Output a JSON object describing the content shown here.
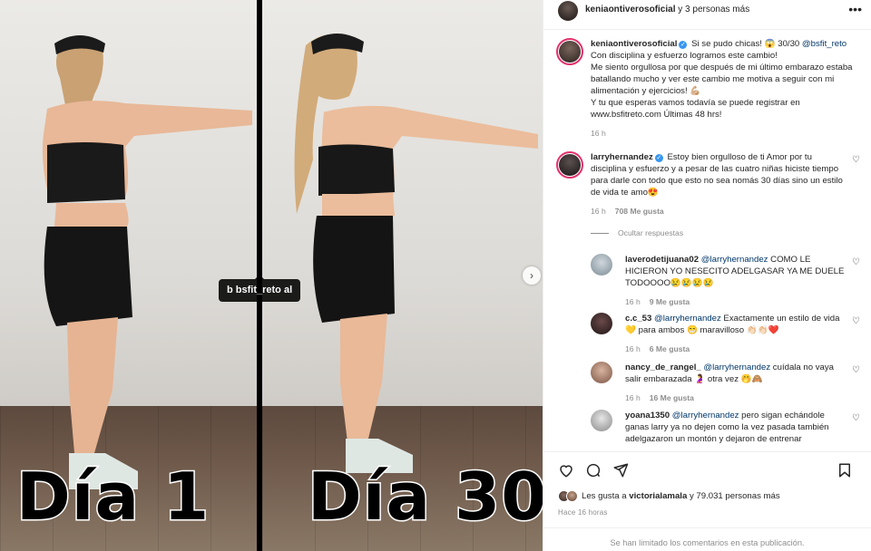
{
  "media": {
    "left_label": "Día 1",
    "right_label": "Día 30",
    "tag_label": "b   bsfit_reto   al",
    "next_icon": "chevron-right-icon"
  },
  "header": {
    "owner": "keniaontiverosoficial",
    "others": " y 3 personas más",
    "more_icon": "more-horizontal-icon"
  },
  "caption": {
    "user": "keniaontiverosoficial",
    "text_1": " Si se pudo chicas! 😱 30/30 ",
    "mention": "@bsfit_reto",
    "text_2": "Con disciplina y esfuerzo logramos este cambio!",
    "text_3": "Me siento orgullosa por que después de mi último embarazo estaba batallando mucho y ver este cambio me motiva a seguir con mi alimentación y ejercicios! 💪🏼",
    "text_4": "Y tu que esperas vamos todavía se puede registrar en www.bsfitreto.com Últimas 48 hrs!",
    "time": "16 h"
  },
  "comment_main": {
    "user": "larryhernandez",
    "text": " Estoy bien orgulloso de ti Amor por tu disciplina y esfuerzo y a pesar de las cuatro niñas hiciste tiempo para darle con todo que esto no sea nomás 30 días sino un estilo de vida te amo😍",
    "time": "16 h",
    "likes": "708 Me gusta"
  },
  "hide_replies": "Ocultar respuestas",
  "replies": [
    {
      "user": "laverodetijuana02",
      "mention": "@larryhernandez",
      "text": " COMO LE HICIERON YO NESECITO ADELGASAR YA ME DUELE TODOOOO😢😢😢😢",
      "time": "16 h",
      "likes": "9 Me gusta"
    },
    {
      "user": "c.c_53",
      "mention": "@larryhernandez",
      "text": " Exactamente un estilo de vida 💛 para ambos 😁 maravilloso 👏🏻👏🏻❤️",
      "time": "16 h",
      "likes": "6 Me gusta"
    },
    {
      "user": "nancy_de_rangel_",
      "mention": "@larryhernandez",
      "text": " cuídala no vaya salir embarazada 🤰 otra vez 🤭🙈",
      "time": "16 h",
      "likes": "16 Me gusta"
    },
    {
      "user": "yoana1350",
      "mention": "@larryhernandez",
      "text": " pero sigan echándole ganas larry ya no dejen como la vez pasada también adelgazaron un montón y dejaron de entrenar",
      "time": "",
      "likes": ""
    }
  ],
  "actions": {
    "like_icon": "heart-icon",
    "comment_icon": "comment-icon",
    "share_icon": "share-icon",
    "save_icon": "bookmark-icon"
  },
  "liked_by": {
    "prefix": "Les gusta a ",
    "user": "victorialamala",
    "suffix": " y 79.031 personas más"
  },
  "posted": "Hace 16 horas",
  "comments_limited": "Se han limitado los comentarios en esta publicación.",
  "colors": {
    "verified": "#3897f0",
    "mention": "#00376b",
    "muted": "#8e8e8e",
    "ring": "#e1306c"
  }
}
